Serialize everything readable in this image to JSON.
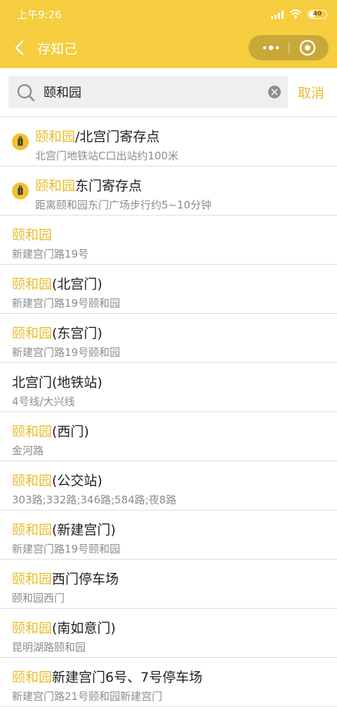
{
  "status_bar": {
    "time": "上午9:26",
    "battery": "40"
  },
  "nav": {
    "title": "存知己"
  },
  "search": {
    "query": "颐和园",
    "cancel_label": "取消"
  },
  "results": [
    {
      "type": "storage",
      "highlight": "颐和园",
      "rest": "/北宫门寄存点",
      "subtitle": "北宫门地铁站C口出站约100米"
    },
    {
      "type": "storage",
      "highlight": "颐和园",
      "rest": "东门寄存点",
      "subtitle": "距离颐和园东门广场步行约5~10分钟"
    },
    {
      "type": "place",
      "highlight": "颐和园",
      "rest": "",
      "subtitle": "新建宫门路19号"
    },
    {
      "type": "place",
      "highlight": "颐和园",
      "rest": "(北宫门)",
      "subtitle": "新建宫门路19号颐和园"
    },
    {
      "type": "place",
      "highlight": "颐和园",
      "rest": "(东宫门)",
      "subtitle": "新建宫门路19号颐和园"
    },
    {
      "type": "place",
      "highlight": "",
      "rest": "北宫门(地铁站)",
      "subtitle": "4号线/大兴线"
    },
    {
      "type": "place",
      "highlight": "颐和园",
      "rest": "(西门)",
      "subtitle": "金河路"
    },
    {
      "type": "place",
      "highlight": "颐和园",
      "rest": "(公交站)",
      "subtitle": "303路;332路;346路;584路;夜8路"
    },
    {
      "type": "place",
      "highlight": "颐和园",
      "rest": "(新建宫门)",
      "subtitle": "新建宫门路19号颐和园"
    },
    {
      "type": "place",
      "highlight": "颐和园",
      "rest": "西门停车场",
      "subtitle": "颐和园西门"
    },
    {
      "type": "place",
      "highlight": "颐和园",
      "rest": "(南如意门)",
      "subtitle": "昆明湖路颐和园"
    },
    {
      "type": "place",
      "highlight": "颐和园",
      "rest": "新建宫门6号、7号停车场",
      "subtitle": "新建宫门路21号颐和园新建宫门"
    }
  ],
  "colors": {
    "brand_yellow": "#f5cd3e",
    "highlight": "#e8bd2c",
    "capsule": "#c9a83a"
  },
  "icons": [
    "back-chevron-icon",
    "more-dots-icon",
    "close-circle-icon",
    "search-icon",
    "clear-icon",
    "luggage-icon"
  ]
}
